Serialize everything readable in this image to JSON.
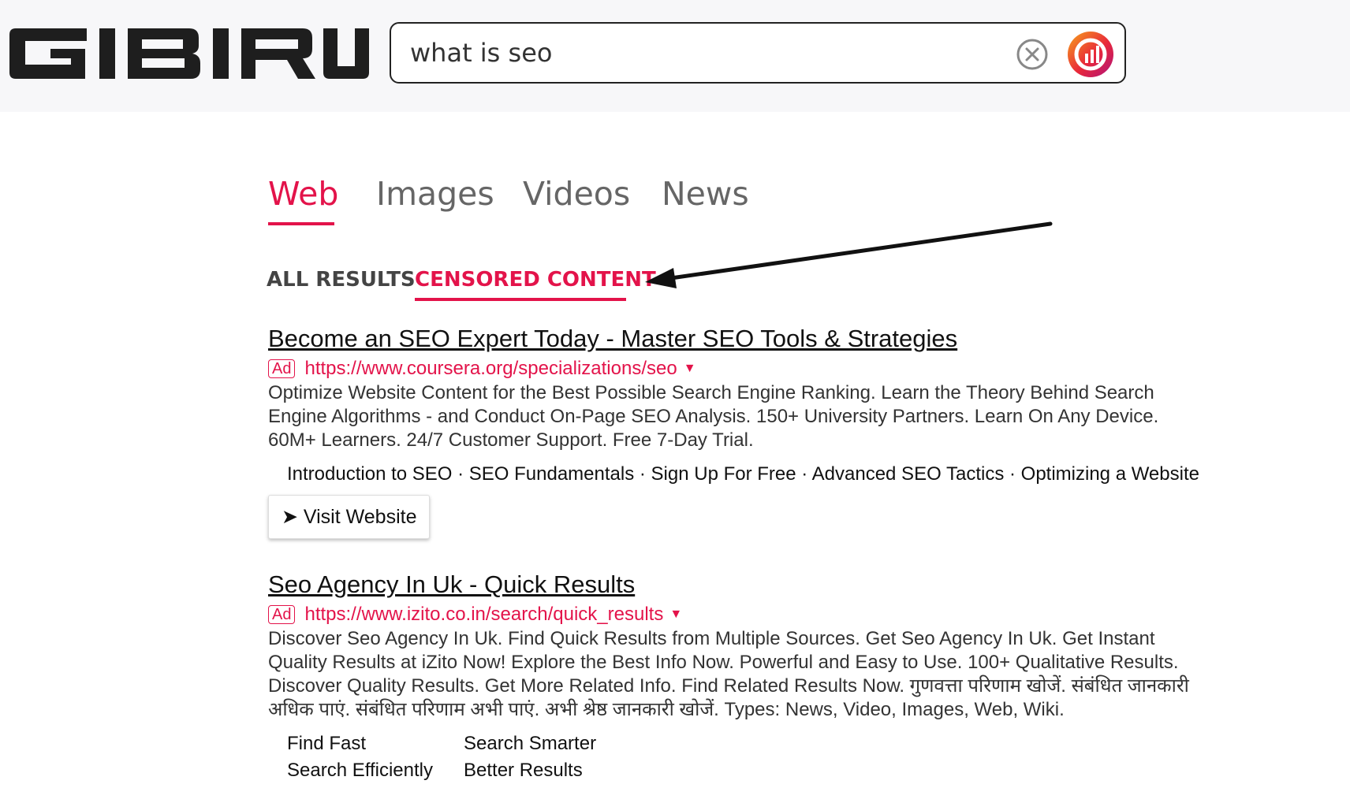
{
  "header": {
    "logo_text": "GIBIRU",
    "search": {
      "value": "what is seo",
      "placeholder": ""
    },
    "clear_icon": "close-circle-icon",
    "brand_icon": "gibiru-app-icon"
  },
  "tabs": [
    {
      "label": "Web",
      "active": true
    },
    {
      "label": "Images",
      "active": false
    },
    {
      "label": "Videos",
      "active": false
    },
    {
      "label": "News",
      "active": false
    }
  ],
  "subtabs": {
    "all": "ALL RESULTS",
    "censored": "CENSORED CONTENT",
    "active": "censored"
  },
  "results": [
    {
      "title": "Become an SEO Expert Today - Master SEO Tools & Strategies",
      "ad_label": "Ad",
      "url": "https://www.coursera.org/specializations/seo",
      "caret": "▼",
      "description": "Optimize Website Content for the Best Possible Search Engine Ranking. Learn the Theory Behind Search Engine Algorithms - and Conduct On-Page SEO Analysis. 150+ University Partners. Learn On Any Device. 60M+ Learners. 24/7 Customer Support. Free 7-Day Trial.",
      "sitelinks": [
        "Introduction to SEO",
        "SEO Fundamentals",
        "Sign Up For Free",
        "Advanced SEO Tactics",
        "Optimizing a Website"
      ],
      "sitelink_separator": " · ",
      "visit_button": "➤ Visit Website"
    },
    {
      "title": "Seo Agency In Uk - Quick Results",
      "ad_label": "Ad",
      "url": "https://www.izito.co.in/search/quick_results",
      "caret": "▼",
      "description": "Discover Seo Agency In Uk. Find Quick Results from Multiple Sources. Get Seo Agency In Uk. Get Instant Quality Results at iZito Now! Explore the Best Info Now. Powerful and Easy to Use. 100+ Qualitative Results. Discover Quality Results. Get More Related Info. Find Related Results Now. गुणवत्ता परिणाम खोजें. संबंधित जानकारी अधिक पाएं. संबंधित परिणाम अभी पाएं. अभी श्रेष्ठ जानकारी खोजें. Types: News, Video, Images, Web, Wiki.",
      "grid_links": [
        [
          "Find Fast",
          "Search Smarter"
        ],
        [
          "Search Efficiently",
          "Better Results"
        ]
      ]
    }
  ],
  "colors": {
    "accent": "#e3134a",
    "logo": "#1e1e1e",
    "header_bg": "#f7f7f9"
  }
}
